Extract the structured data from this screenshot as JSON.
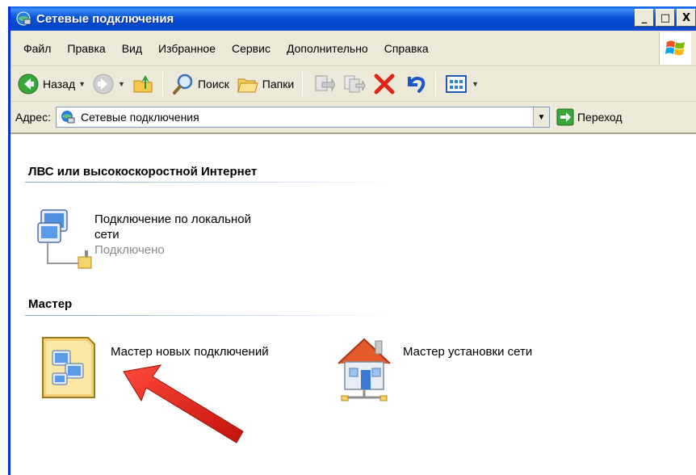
{
  "window": {
    "title": "Сетевые подключения",
    "buttons": {
      "minimize": "_",
      "maximize": "□",
      "close": "X"
    }
  },
  "menu": {
    "items": [
      "Файл",
      "Правка",
      "Вид",
      "Избранное",
      "Сервис",
      "Дополнительно",
      "Справка"
    ]
  },
  "toolbar": {
    "back_label": "Назад",
    "search_label": "Поиск",
    "folders_label": "Папки"
  },
  "address": {
    "label": "Адрес:",
    "value": "Сетевые подключения",
    "go_label": "Переход"
  },
  "groups": [
    {
      "header": "ЛВС или высокоскоростной Интернет",
      "items": [
        {
          "name_line1": "Подключение по локальной",
          "name_line2": "сети",
          "status": "Подключено",
          "icon": "lan-connection-icon"
        }
      ]
    },
    {
      "header": "Мастер",
      "items": [
        {
          "name": "Мастер новых подключений",
          "icon": "new-connection-wizard-icon"
        },
        {
          "name": "Мастер установки сети",
          "icon": "network-setup-wizard-icon"
        }
      ]
    }
  ],
  "colors": {
    "titlebar": "#0753d8",
    "chrome": "#ece9d8",
    "status_gray": "#8a8a8a",
    "annotation_arrow": "#e8231a"
  }
}
